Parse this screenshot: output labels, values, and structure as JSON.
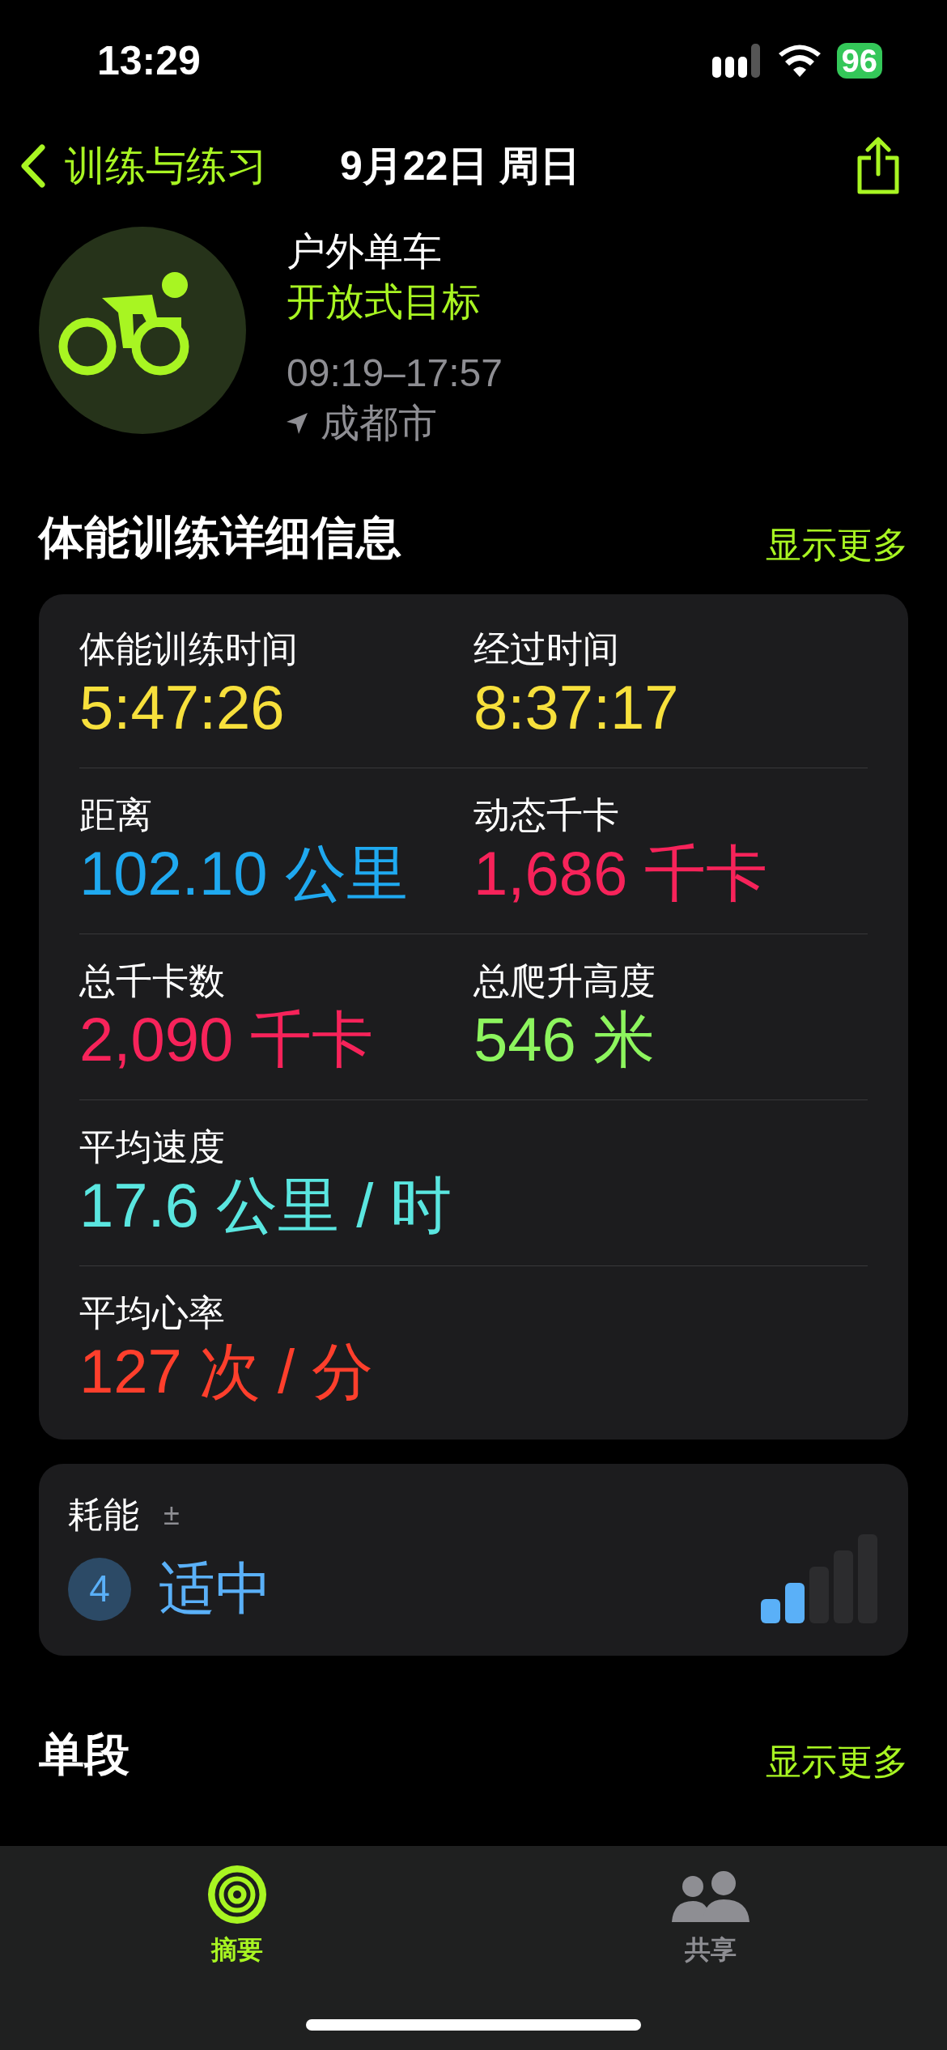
{
  "status_bar": {
    "time": "13:29",
    "battery": "96"
  },
  "nav": {
    "back": "训练与练习",
    "title": "9月22日 周日"
  },
  "workout": {
    "name": "户外单车",
    "goal": "开放式目标",
    "time_range": "09:19–17:57",
    "location": "成都市"
  },
  "details": {
    "title": "体能训练详细信息",
    "more": "显示更多",
    "rows": [
      [
        {
          "label": "体能训练时间",
          "value": "5:47:26",
          "color": "#f7e03c"
        },
        {
          "label": "经过时间",
          "value": "8:37:17",
          "color": "#f7e03c"
        }
      ],
      [
        {
          "label": "距离",
          "value": "102.10 公里",
          "color": "#1fa9f0"
        },
        {
          "label": "动态千卡",
          "value": "1,686 千卡",
          "color": "#f7235a"
        }
      ],
      [
        {
          "label": "总千卡数",
          "value": "2,090 千卡",
          "color": "#f7235a"
        },
        {
          "label": "总爬升高度",
          "value": "546 米",
          "color": "#8df55e"
        }
      ],
      [
        {
          "label": "平均速度",
          "value": "17.6 公里 / 时",
          "color": "#5ae6e0"
        }
      ],
      [
        {
          "label": "平均心率",
          "value": "127 次 / 分",
          "color": "#fe3f2c"
        }
      ]
    ]
  },
  "effort": {
    "label": "耗能",
    "adjust": "±",
    "score": "4",
    "rating": "适中",
    "level": 0.4
  },
  "splits": {
    "title": "单段",
    "more": "显示更多"
  },
  "tabs": [
    {
      "label": "摘要",
      "kind": "summary",
      "selected": true
    },
    {
      "label": "共享",
      "kind": "sharing",
      "selected": false
    }
  ]
}
